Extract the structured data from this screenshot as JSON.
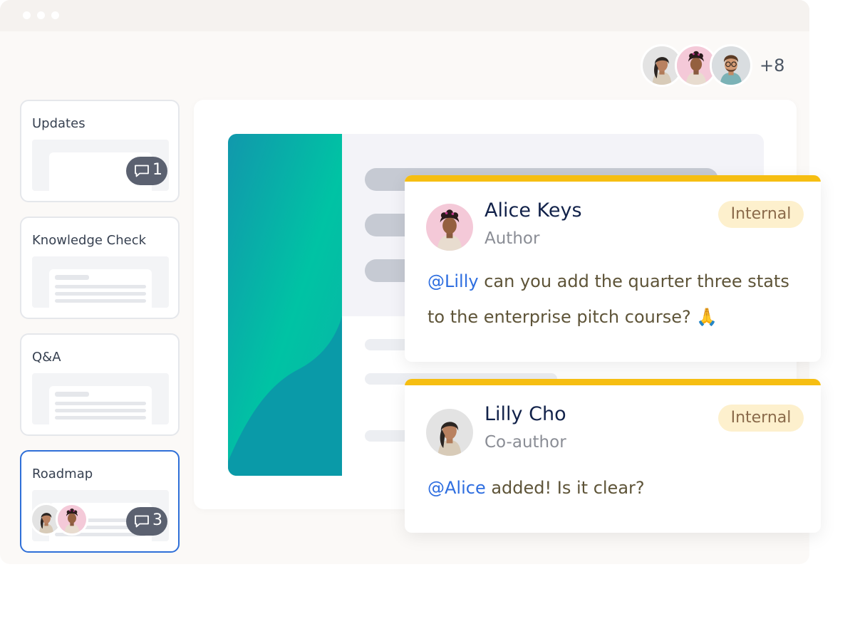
{
  "top_bar": {
    "collaborators_extra_count": "+8"
  },
  "sidebar": {
    "slides": [
      {
        "title": "Updates",
        "comment_count": "1"
      },
      {
        "title": "Knowledge Check"
      },
      {
        "title": "Q&A"
      },
      {
        "title": "Roadmap",
        "comment_count": "3"
      }
    ]
  },
  "comments": [
    {
      "name": "Alice Keys",
      "role": "Author",
      "tag": "Internal",
      "mention": "@Lilly",
      "text": " can you add the quarter three stats to the enterprise pitch course? 🙏"
    },
    {
      "name": "Lilly Cho",
      "role": "Co-author",
      "tag": "Internal",
      "mention": "@Alice",
      "text": " added! Is it clear?"
    }
  ],
  "colors": {
    "accent_blue": "#2f6fd8",
    "mention_blue": "#2e6ee0",
    "comment_top_bar": "#f6be12",
    "tag_bg": "#fdf0cd",
    "teal_gradient_start": "#0f9bb0",
    "teal_gradient_mid": "#00c3a4"
  },
  "icons": {
    "comment_badge": "comment-bubble-icon",
    "avatar": "person-avatar"
  }
}
